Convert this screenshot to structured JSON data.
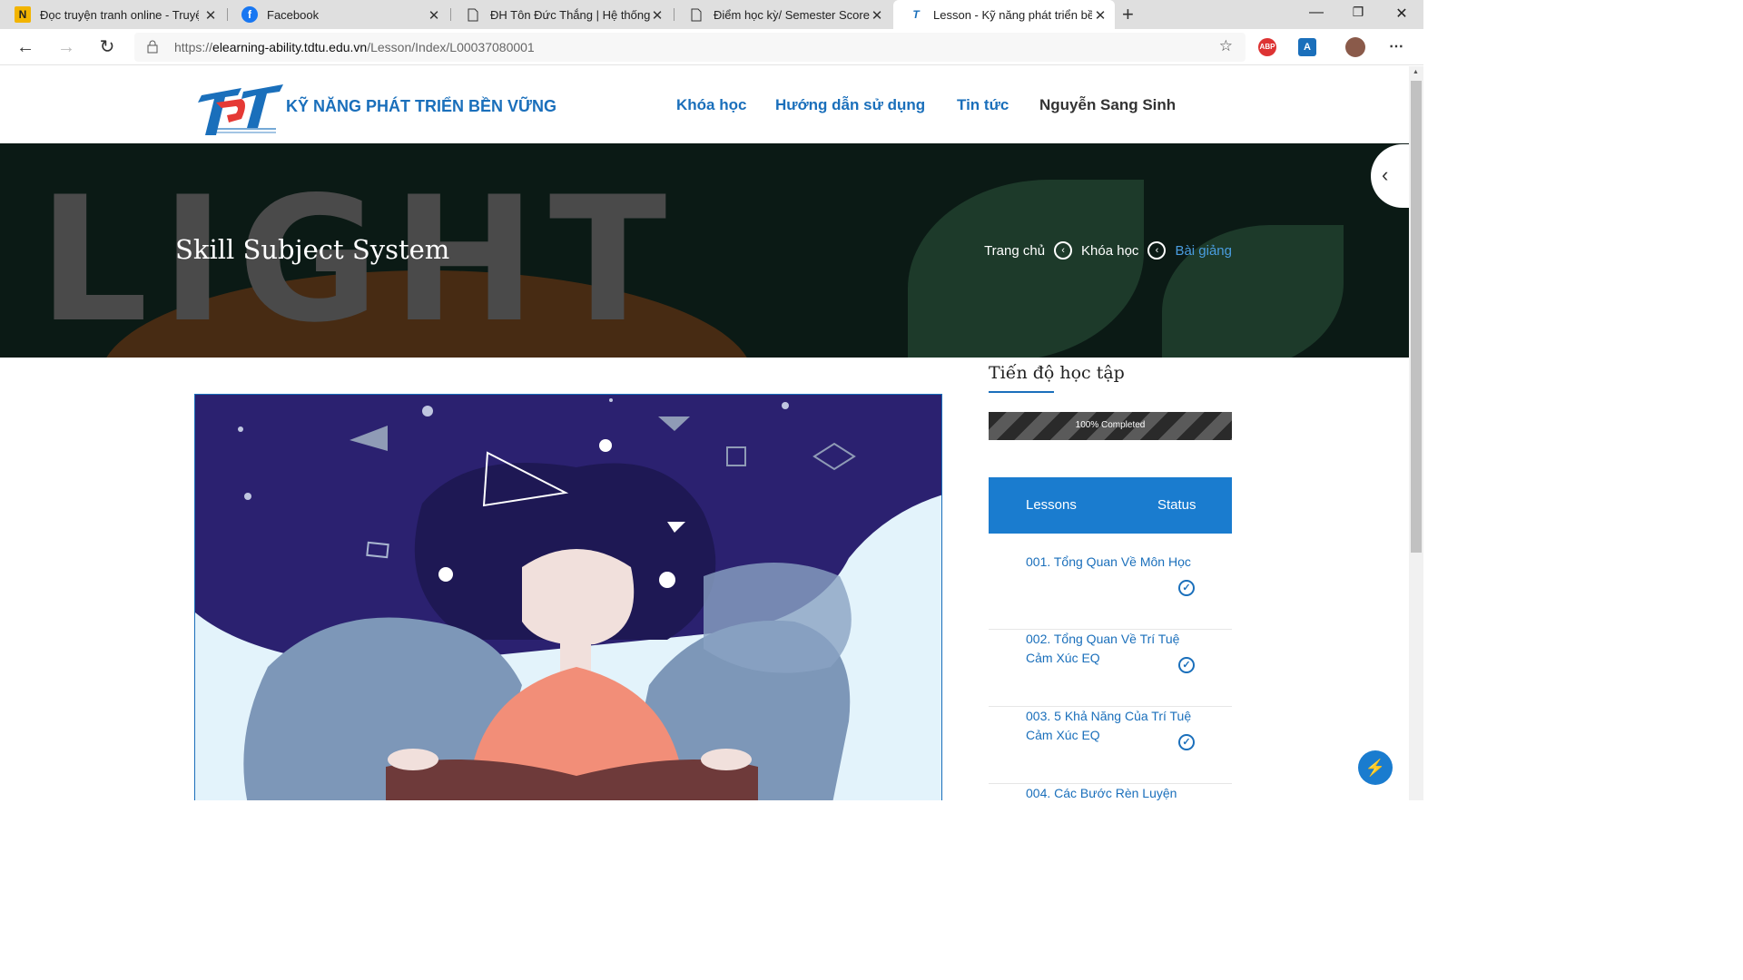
{
  "browser": {
    "tabs": [
      {
        "title": "Đọc truyện tranh online - Truyện",
        "favicon": "n-icon"
      },
      {
        "title": "Facebook",
        "favicon": "facebook-icon"
      },
      {
        "title": "ĐH Tôn Đức Thắng | Hệ thống th",
        "favicon": "page-icon"
      },
      {
        "title": "Điểm học kỳ/ Semester Score",
        "favicon": "page-icon"
      },
      {
        "title": "Lesson - Kỹ năng phát triển bền",
        "favicon": "tdt-icon"
      }
    ],
    "url_prefix": "https://",
    "url_host": "elearning-ability.tdtu.edu.vn",
    "url_path": "/Lesson/Index/L00037080001"
  },
  "header": {
    "brand": "KỸ NĂNG PHÁT TRIỂN BỀN VỮNG",
    "nav": [
      "Khóa học",
      "Hướng dẫn sử dụng",
      "Tin tức"
    ],
    "user": "Nguyễn Sang Sinh"
  },
  "hero": {
    "bg_text": "LIGHT",
    "title": "Skill Subject System",
    "breadcrumb": [
      "Trang chủ",
      "Khóa học",
      "Bài giảng"
    ]
  },
  "sidebar": {
    "title": "Tiến độ học tập",
    "progress_label": "100% Completed",
    "progress_value": 100,
    "col_lessons": "Lessons",
    "col_status": "Status",
    "lessons": [
      {
        "title": "001. Tổng Quan Về Môn Học",
        "done": true
      },
      {
        "title": "002. Tổng Quan Về Trí Tuệ Cảm Xúc EQ",
        "done": true
      },
      {
        "title": "003. 5 Khả Năng Của Trí Tuệ Cảm Xúc EQ",
        "done": true
      },
      {
        "title": "004. Các Bước Rèn Luyện",
        "done": true
      }
    ]
  },
  "colors": {
    "accent": "#1a6fbb",
    "header_blue": "#1a7ccf"
  }
}
